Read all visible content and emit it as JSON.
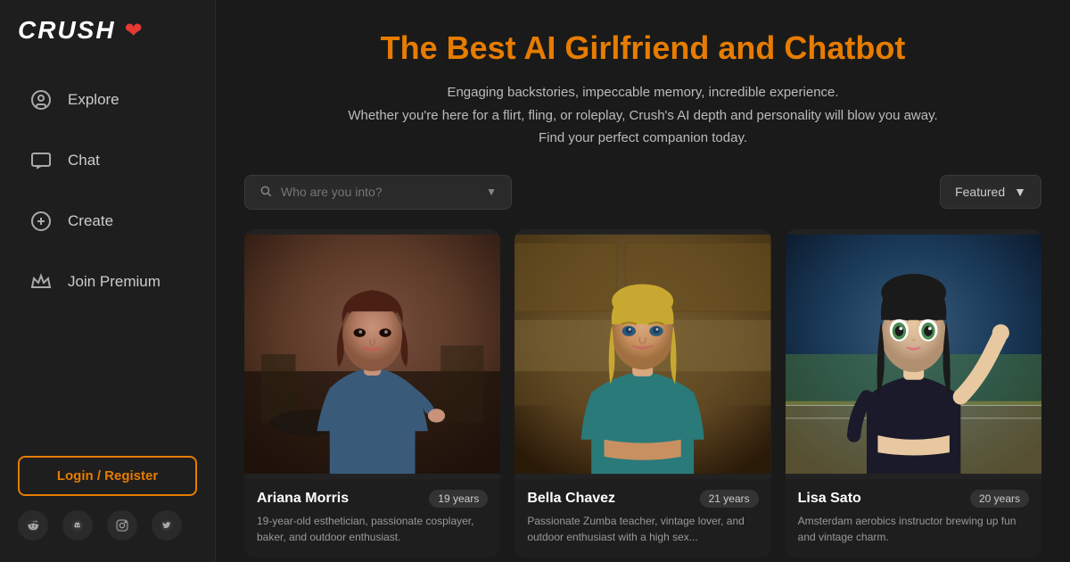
{
  "logo": {
    "text": "CRUSH",
    "heart": "❤"
  },
  "nav": {
    "items": [
      {
        "id": "explore",
        "label": "Explore",
        "icon": "explore"
      },
      {
        "id": "chat",
        "label": "Chat",
        "icon": "chat"
      },
      {
        "id": "create",
        "label": "Create",
        "icon": "create"
      },
      {
        "id": "premium",
        "label": "Join Premium",
        "icon": "crown"
      }
    ]
  },
  "sidebar_bottom": {
    "login_label": "Login / Register"
  },
  "social": [
    {
      "id": "reddit",
      "icon": "r"
    },
    {
      "id": "discord",
      "icon": "d"
    },
    {
      "id": "instagram",
      "icon": "i"
    },
    {
      "id": "twitter",
      "icon": "t"
    }
  ],
  "hero": {
    "title": "The Best AI Girlfriend and Chatbot",
    "line1": "Engaging backstories, impeccable memory, incredible experience.",
    "line2": "Whether you're here for a flirt, fling, or roleplay, Crush's AI depth and personality will blow you away.",
    "line3": "Find your perfect companion today."
  },
  "search": {
    "placeholder": "Who are you into?"
  },
  "filter": {
    "label": "Featured",
    "chevron": "▼"
  },
  "cards": [
    {
      "name": "Ariana Morris",
      "age": "19 years",
      "desc": "19-year-old esthetician, passionate cosplayer, baker, and outdoor enthusiast.",
      "img_color_top": "#5c3d2e",
      "img_color_mid": "#8b6050",
      "img_color_bot": "#3a2418"
    },
    {
      "name": "Bella Chavez",
      "age": "21 years",
      "desc": "Passionate Zumba teacher, vintage lover, and outdoor enthusiast with a high sex...",
      "img_color_top": "#6b5a30",
      "img_color_mid": "#9a8a50",
      "img_color_bot": "#4a3a18"
    },
    {
      "name": "Lisa Sato",
      "age": "20 years",
      "desc": "Amsterdam aerobics instructor brewing up fun and vintage charm.",
      "img_color_top": "#1a2535",
      "img_color_mid": "#2a3a50",
      "img_color_bot": "#0a1525"
    }
  ]
}
